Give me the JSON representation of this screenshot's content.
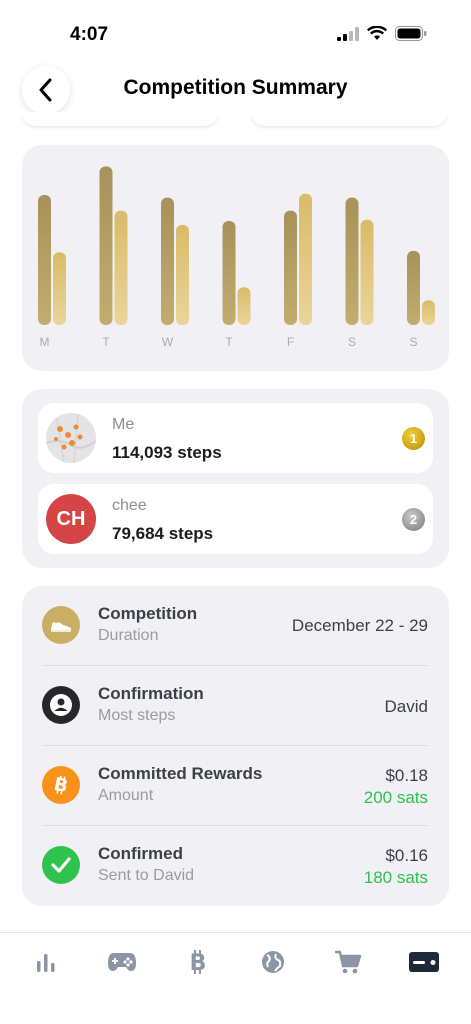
{
  "status_bar": {
    "time": "4:07"
  },
  "header": {
    "title": "Competition Summary"
  },
  "chart_data": {
    "type": "bar",
    "categories": [
      "M",
      "T",
      "W",
      "T",
      "F",
      "S",
      "S"
    ],
    "series": [
      {
        "values": [
          100,
          122,
          98,
          80,
          88,
          98,
          57
        ]
      },
      {
        "values": [
          56,
          88,
          77,
          29,
          101,
          81,
          19
        ]
      }
    ],
    "colors": [
      "#b3a062",
      "#e1c47a"
    ],
    "grid": false
  },
  "leaderboard": [
    {
      "name": "Me",
      "steps": "114,093 steps",
      "rank": "1",
      "initials": ""
    },
    {
      "name": "chee",
      "steps": "79,684 steps",
      "rank": "2",
      "initials": "CH"
    }
  ],
  "details": {
    "competition": {
      "title": "Competition",
      "subtitle": "Duration",
      "value": "December 22 - 29"
    },
    "confirmation": {
      "title": "Confirmation",
      "subtitle": "Most steps",
      "value": "David"
    },
    "rewards": {
      "title": "Committed Rewards",
      "subtitle": "Amount",
      "value": "$0.18",
      "sats": "200 sats"
    },
    "confirmed": {
      "title": "Confirmed",
      "subtitle": "Sent to David",
      "value": "$0.16",
      "sats": "180 sats"
    }
  },
  "tabs": [
    "stats-icon",
    "gamepad-icon",
    "bitcoin-icon",
    "globe-icon",
    "cart-icon",
    "wallet-card-icon"
  ],
  "colors": {
    "accent_green": "#2fc24c",
    "bitcoin_orange": "#f7931a",
    "gold": "#c9ae64"
  }
}
